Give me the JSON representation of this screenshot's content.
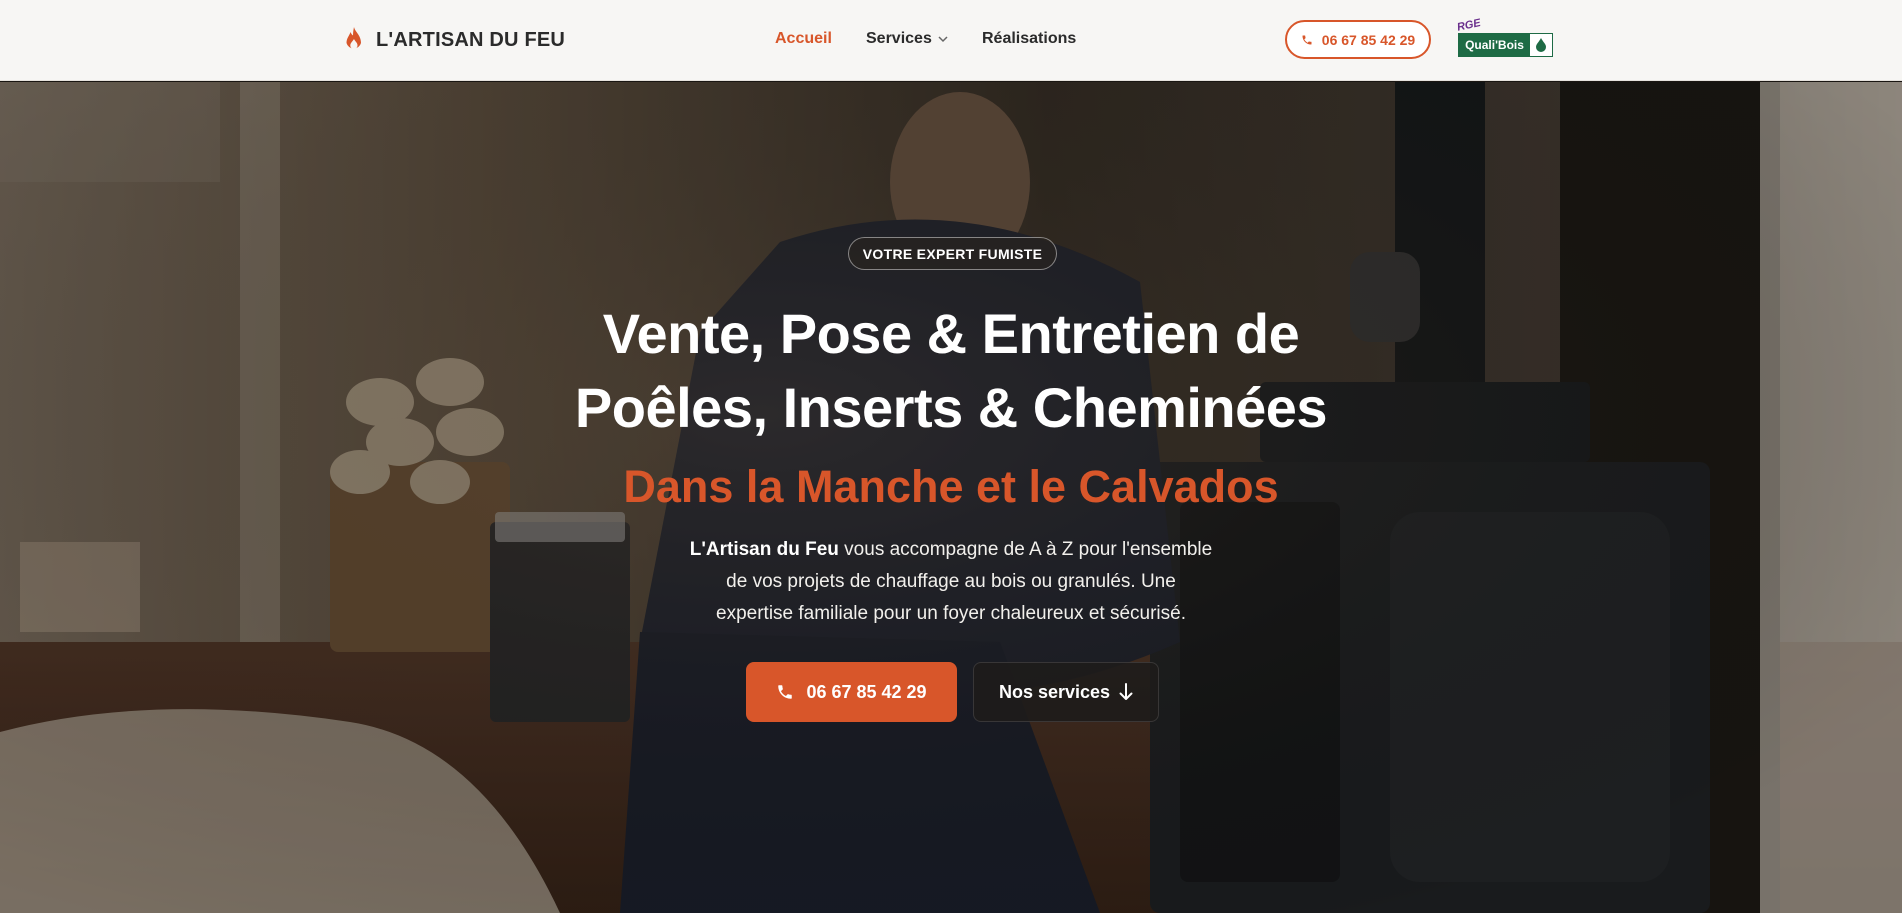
{
  "header": {
    "brand": "L'ARTISAN DU FEU",
    "nav": [
      {
        "label": "Accueil",
        "active": true
      },
      {
        "label": "Services",
        "active": false,
        "has_dropdown": true
      },
      {
        "label": "Réalisations",
        "active": false
      }
    ],
    "phone": "06 67 85 42 29",
    "certification": {
      "rge": "RGE",
      "label": "Quali'Bois"
    }
  },
  "hero": {
    "eyebrow": "VOTRE EXPERT FUMISTE",
    "title_line1": "Vente, Pose & Entretien de",
    "title_line2": "Poêles, Inserts & Cheminées",
    "subtitle": "Dans la Manche et le Calvados",
    "desc_brand": "L'Artisan du Feu",
    "desc_line1_rest": " vous accompagne de A à Z pour l'ensemble",
    "desc_line2": "de vos projets de chauffage au bois ou granulés. Une",
    "desc_line3": "expertise familiale pour un foyer chaleureux et sécurisé.",
    "cta_phone": "06 67 85 42 29",
    "cta_services": "Nos services"
  },
  "icons": [
    "flame-icon",
    "chevron-down-icon",
    "phone-icon",
    "leaf-drop-icon",
    "arrow-down-icon"
  ],
  "colors": {
    "accent": "#d8562a",
    "header_bg": "#f7f6f4",
    "text_dark": "#2b2b2b",
    "rge_green": "#1e6b45",
    "rge_purple": "#6a2f8c"
  }
}
